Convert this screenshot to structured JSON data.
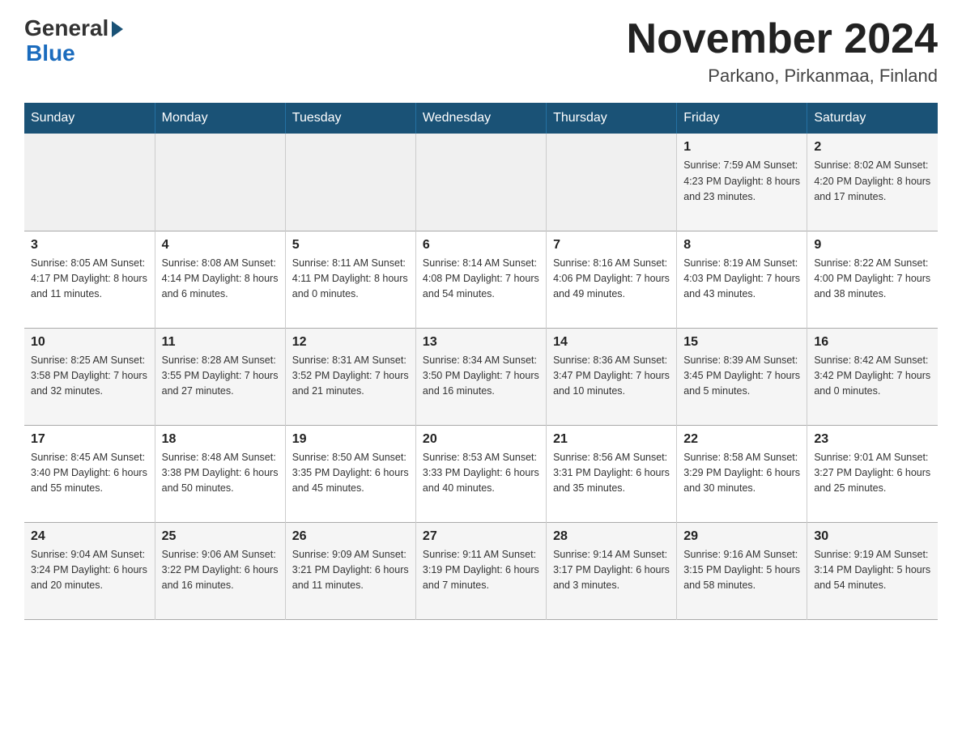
{
  "header": {
    "logo_general": "General",
    "logo_blue": "Blue",
    "month_title": "November 2024",
    "subtitle": "Parkano, Pirkanmaa, Finland"
  },
  "days_of_week": [
    "Sunday",
    "Monday",
    "Tuesday",
    "Wednesday",
    "Thursday",
    "Friday",
    "Saturday"
  ],
  "weeks": [
    [
      {
        "day": "",
        "info": ""
      },
      {
        "day": "",
        "info": ""
      },
      {
        "day": "",
        "info": ""
      },
      {
        "day": "",
        "info": ""
      },
      {
        "day": "",
        "info": ""
      },
      {
        "day": "1",
        "info": "Sunrise: 7:59 AM\nSunset: 4:23 PM\nDaylight: 8 hours\nand 23 minutes."
      },
      {
        "day": "2",
        "info": "Sunrise: 8:02 AM\nSunset: 4:20 PM\nDaylight: 8 hours\nand 17 minutes."
      }
    ],
    [
      {
        "day": "3",
        "info": "Sunrise: 8:05 AM\nSunset: 4:17 PM\nDaylight: 8 hours\nand 11 minutes."
      },
      {
        "day": "4",
        "info": "Sunrise: 8:08 AM\nSunset: 4:14 PM\nDaylight: 8 hours\nand 6 minutes."
      },
      {
        "day": "5",
        "info": "Sunrise: 8:11 AM\nSunset: 4:11 PM\nDaylight: 8 hours\nand 0 minutes."
      },
      {
        "day": "6",
        "info": "Sunrise: 8:14 AM\nSunset: 4:08 PM\nDaylight: 7 hours\nand 54 minutes."
      },
      {
        "day": "7",
        "info": "Sunrise: 8:16 AM\nSunset: 4:06 PM\nDaylight: 7 hours\nand 49 minutes."
      },
      {
        "day": "8",
        "info": "Sunrise: 8:19 AM\nSunset: 4:03 PM\nDaylight: 7 hours\nand 43 minutes."
      },
      {
        "day": "9",
        "info": "Sunrise: 8:22 AM\nSunset: 4:00 PM\nDaylight: 7 hours\nand 38 minutes."
      }
    ],
    [
      {
        "day": "10",
        "info": "Sunrise: 8:25 AM\nSunset: 3:58 PM\nDaylight: 7 hours\nand 32 minutes."
      },
      {
        "day": "11",
        "info": "Sunrise: 8:28 AM\nSunset: 3:55 PM\nDaylight: 7 hours\nand 27 minutes."
      },
      {
        "day": "12",
        "info": "Sunrise: 8:31 AM\nSunset: 3:52 PM\nDaylight: 7 hours\nand 21 minutes."
      },
      {
        "day": "13",
        "info": "Sunrise: 8:34 AM\nSunset: 3:50 PM\nDaylight: 7 hours\nand 16 minutes."
      },
      {
        "day": "14",
        "info": "Sunrise: 8:36 AM\nSunset: 3:47 PM\nDaylight: 7 hours\nand 10 minutes."
      },
      {
        "day": "15",
        "info": "Sunrise: 8:39 AM\nSunset: 3:45 PM\nDaylight: 7 hours\nand 5 minutes."
      },
      {
        "day": "16",
        "info": "Sunrise: 8:42 AM\nSunset: 3:42 PM\nDaylight: 7 hours\nand 0 minutes."
      }
    ],
    [
      {
        "day": "17",
        "info": "Sunrise: 8:45 AM\nSunset: 3:40 PM\nDaylight: 6 hours\nand 55 minutes."
      },
      {
        "day": "18",
        "info": "Sunrise: 8:48 AM\nSunset: 3:38 PM\nDaylight: 6 hours\nand 50 minutes."
      },
      {
        "day": "19",
        "info": "Sunrise: 8:50 AM\nSunset: 3:35 PM\nDaylight: 6 hours\nand 45 minutes."
      },
      {
        "day": "20",
        "info": "Sunrise: 8:53 AM\nSunset: 3:33 PM\nDaylight: 6 hours\nand 40 minutes."
      },
      {
        "day": "21",
        "info": "Sunrise: 8:56 AM\nSunset: 3:31 PM\nDaylight: 6 hours\nand 35 minutes."
      },
      {
        "day": "22",
        "info": "Sunrise: 8:58 AM\nSunset: 3:29 PM\nDaylight: 6 hours\nand 30 minutes."
      },
      {
        "day": "23",
        "info": "Sunrise: 9:01 AM\nSunset: 3:27 PM\nDaylight: 6 hours\nand 25 minutes."
      }
    ],
    [
      {
        "day": "24",
        "info": "Sunrise: 9:04 AM\nSunset: 3:24 PM\nDaylight: 6 hours\nand 20 minutes."
      },
      {
        "day": "25",
        "info": "Sunrise: 9:06 AM\nSunset: 3:22 PM\nDaylight: 6 hours\nand 16 minutes."
      },
      {
        "day": "26",
        "info": "Sunrise: 9:09 AM\nSunset: 3:21 PM\nDaylight: 6 hours\nand 11 minutes."
      },
      {
        "day": "27",
        "info": "Sunrise: 9:11 AM\nSunset: 3:19 PM\nDaylight: 6 hours\nand 7 minutes."
      },
      {
        "day": "28",
        "info": "Sunrise: 9:14 AM\nSunset: 3:17 PM\nDaylight: 6 hours\nand 3 minutes."
      },
      {
        "day": "29",
        "info": "Sunrise: 9:16 AM\nSunset: 3:15 PM\nDaylight: 5 hours\nand 58 minutes."
      },
      {
        "day": "30",
        "info": "Sunrise: 9:19 AM\nSunset: 3:14 PM\nDaylight: 5 hours\nand 54 minutes."
      }
    ]
  ]
}
